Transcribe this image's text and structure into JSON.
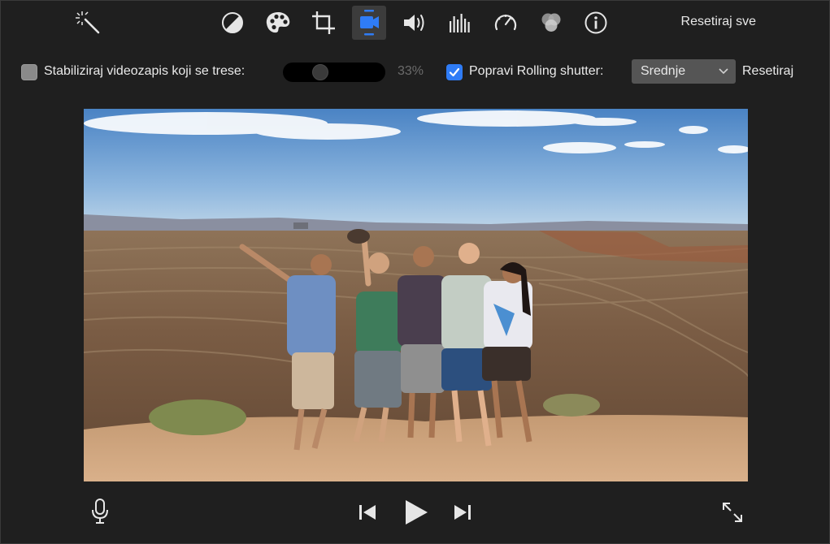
{
  "toolbar": {
    "tools": [
      {
        "icon": "magic-wand-icon"
      },
      {
        "icon": "color-balance-icon"
      },
      {
        "icon": "color-palette-icon"
      },
      {
        "icon": "crop-icon"
      },
      {
        "icon": "stabilization-camera-icon",
        "active": true
      },
      {
        "icon": "volume-icon"
      },
      {
        "icon": "equalizer-icon"
      },
      {
        "icon": "speedometer-icon"
      },
      {
        "icon": "video-filter-icon"
      },
      {
        "icon": "info-icon"
      }
    ],
    "reset_all_label": "Resetiraj sve"
  },
  "options": {
    "stabilize": {
      "checked": false,
      "label": "Stabiliziraj videozapis koji se trese:",
      "amount_percent": 33,
      "amount_label": "33%"
    },
    "rolling_shutter": {
      "checked": true,
      "label": "Popravi Rolling shutter:",
      "selected": "Srednje"
    },
    "reset_label": "Resetiraj"
  },
  "colors": {
    "accent": "#2f7cf6",
    "background": "#1f1f1f",
    "active_tool": "#3c3c3c"
  },
  "viewer": {
    "content": "video-frame"
  },
  "playback": {
    "mic": "microphone-icon",
    "prev": "skip-back-icon",
    "play": "play-icon",
    "next": "skip-forward-icon",
    "fullscreen": "fullscreen-icon"
  }
}
